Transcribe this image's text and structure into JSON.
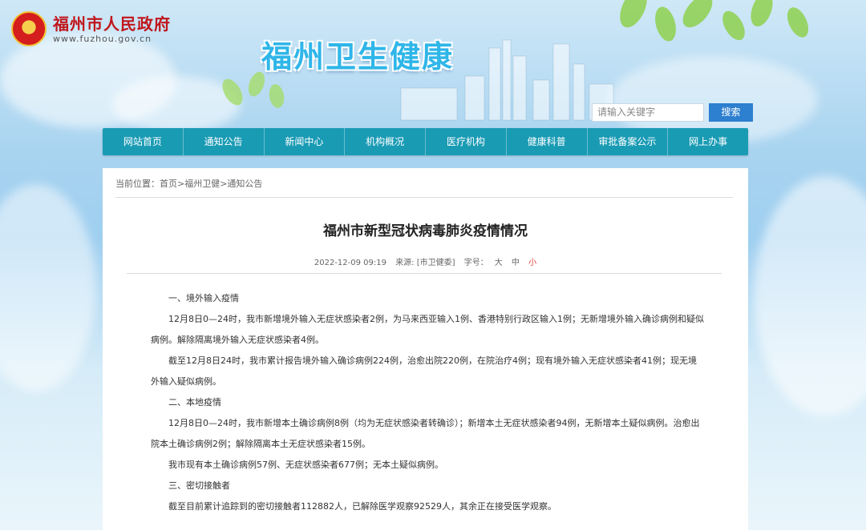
{
  "header": {
    "gov_name": "福州市人民政府",
    "gov_url": "www.fuzhou.gov.cn",
    "site_title": "福州卫生健康",
    "search_placeholder": "请输入关键字",
    "search_button": "搜索"
  },
  "nav": [
    "网站首页",
    "通知公告",
    "新闻中心",
    "机构概况",
    "医疗机构",
    "健康科普",
    "审批备案公示",
    "网上办事"
  ],
  "breadcrumb": "当前位置：首页>福州卫健>通知公告",
  "article": {
    "title": "福州市新型冠状病毒肺炎疫情情况",
    "date": "2022-12-09 09:19",
    "source": "来源: [市卫健委]",
    "font_size_label": "字号：",
    "size_large": "大",
    "size_medium": "中",
    "size_small": "小",
    "paragraphs": [
      "一、境外输入疫情",
      "12月8日0—24时，我市新增境外输入无症状感染者2例，为马来西亚输入1例、香港特别行政区输入1例；无新增境外输入确诊病例和疑似病例。解除隔离境外输入无症状感染者4例。",
      "截至12月8日24时，我市累计报告境外输入确诊病例224例，治愈出院220例，在院治疗4例；现有境外输入无症状感染者41例；现无境外输入疑似病例。",
      "二、本地疫情",
      "12月8日0—24时，我市新增本土确诊病例8例（均为无症状感染者转确诊）；新增本土无症状感染者94例，无新增本土疑似病例。治愈出院本土确诊病例2例；解除隔离本土无症状感染者15例。",
      "我市现有本土确诊病例57例、无症状感染者677例；无本土疑似病例。",
      "三、密切接触者",
      "截至目前累计追踪到的密切接触者112882人，已解除医学观察92529人，其余正在接受医学观察。"
    ]
  },
  "colors": {
    "nav_bg": "#1a9bb4",
    "search_btn": "#2d7fd0",
    "gov_red": "#c0161c",
    "title_blue": "#2fb6e9"
  }
}
